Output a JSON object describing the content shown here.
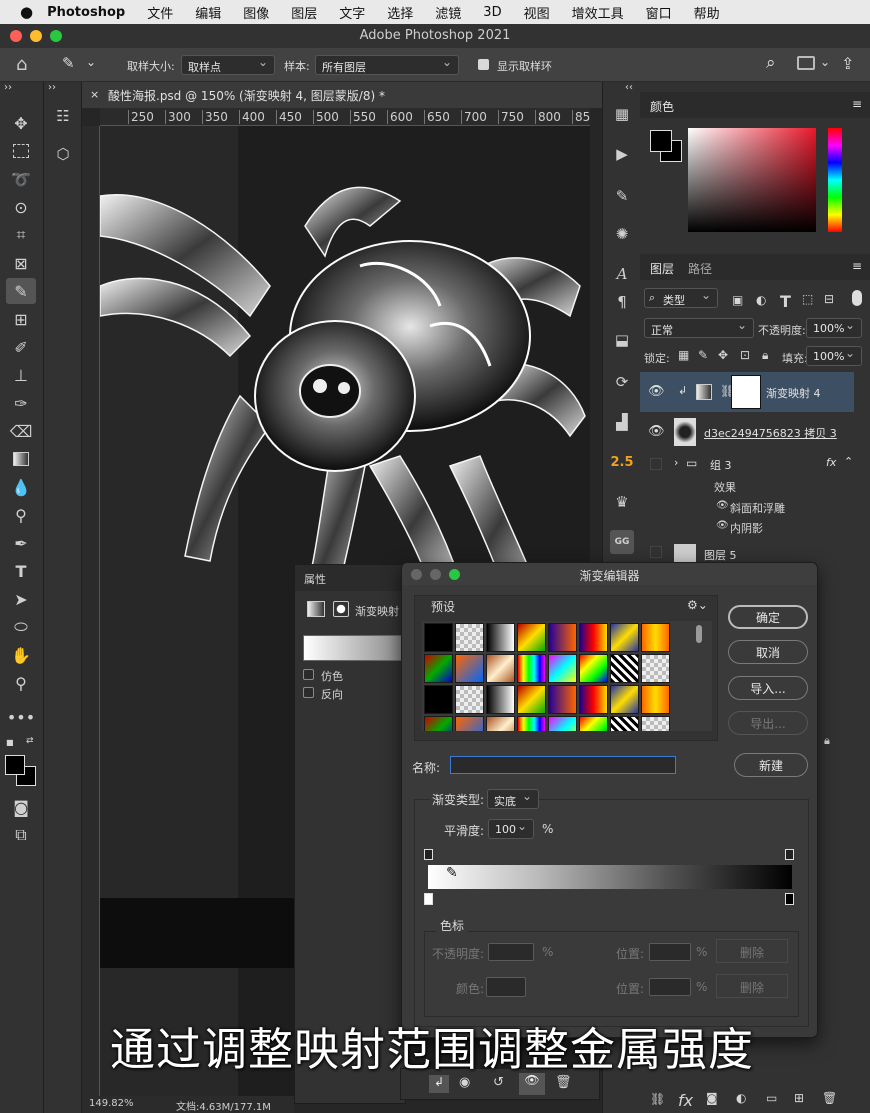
{
  "menubar": {
    "apple": "",
    "items": [
      "Photoshop",
      "文件",
      "编辑",
      "图像",
      "图层",
      "文字",
      "选择",
      "滤镜",
      "3D",
      "视图",
      "增效工具",
      "窗口",
      "帮助"
    ]
  },
  "window": {
    "title": "Adobe Photoshop 2021"
  },
  "options": {
    "sample_size_label": "取样大小:",
    "sample_size_value": "取样点",
    "sample_label": "样本:",
    "sample_value": "所有图层",
    "show_ring_label": "显示取样环"
  },
  "document": {
    "tab_title": "酸性海报.psd @ 150% (渐变映射 4, 图层蒙版/8) *",
    "ruler_ticks": [
      "250",
      "300",
      "350",
      "400",
      "450",
      "500",
      "550",
      "600",
      "650",
      "700",
      "750",
      "800",
      "85"
    ],
    "zoom": "149.82%",
    "doc_size": "文档:4.63M/177.1M"
  },
  "panels": {
    "color_tab": "颜色",
    "layers_tab": "图层",
    "paths_tab": "路径",
    "filter_label": "类型",
    "blend_mode": "正常",
    "opacity_label": "不透明度:",
    "opacity_value": "100%",
    "lock_label": "锁定:",
    "fill_label": "填充:",
    "fill_value": "100%",
    "layers": [
      {
        "name": "渐变映射 4"
      },
      {
        "name": "d3ec2494756823 拷贝 3"
      },
      {
        "name": "组 3"
      },
      {
        "name": "效果"
      },
      {
        "name": "斜面和浮雕"
      },
      {
        "name": "内阴影"
      },
      {
        "name": "图层 5"
      }
    ],
    "fx_label": "fx"
  },
  "properties": {
    "tab": "属性",
    "adjustment_label": "渐变映射",
    "dither_label": "仿色",
    "reverse_label": "反向"
  },
  "gradient_editor": {
    "title": "渐变编辑器",
    "presets_label": "预设",
    "ok": "确定",
    "cancel": "取消",
    "import": "导入...",
    "export": "导出...",
    "name_label": "名称:",
    "new": "新建",
    "type_label": "渐变类型:",
    "type_value": "实底",
    "smooth_label": "平滑度:",
    "smooth_value": "100",
    "smooth_unit": "%",
    "stops_label": "色标",
    "opacity_label": "不透明度:",
    "opacity_unit": "%",
    "location_label": "位置:",
    "location_unit": "%",
    "delete": "删除",
    "color_label": "颜色:"
  },
  "subtitle": "通过调整映射范围调整金属强度"
}
